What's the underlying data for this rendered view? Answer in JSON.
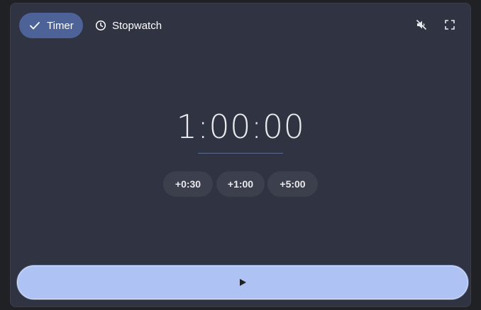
{
  "tabs": {
    "timer_label": "Timer",
    "stopwatch_label": "Stopwatch"
  },
  "timer": {
    "display": "1:00:00"
  },
  "add_buttons": {
    "add_30": "+0:30",
    "add_100": "+1:00",
    "add_500": "+5:00"
  },
  "icons": {
    "timer_tab": "check-icon",
    "stopwatch_tab": "clock-icon",
    "mute": "volume-off-icon",
    "fullscreen": "fullscreen-icon",
    "start": "play-icon"
  },
  "colors": {
    "panel_bg": "#303341",
    "active_tab": "#4d6297",
    "start_button": "#aec2f4",
    "chip_bg": "#3c3f4c",
    "text": "#e8eaed"
  }
}
